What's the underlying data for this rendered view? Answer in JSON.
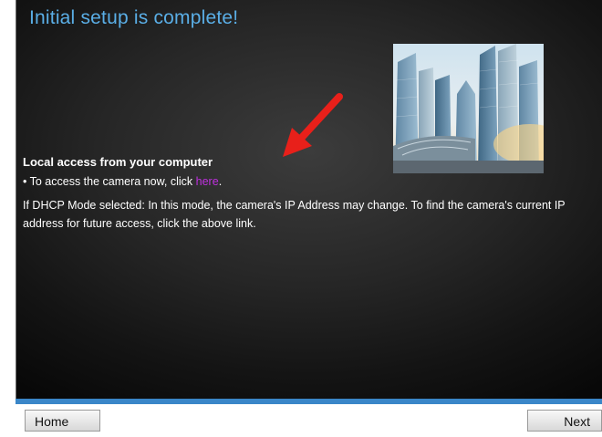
{
  "page": {
    "title": "Initial setup is complete!"
  },
  "content": {
    "heading": "Local access from your computer",
    "bullet_prefix": "• To access the camera now, click ",
    "link_text": "here",
    "bullet_suffix": ".",
    "dhcp_note": "If DHCP Mode selected: In this mode, the camera's IP Address may change. To find the camera's current IP address for future access, click the above link."
  },
  "footer": {
    "home_label": "Home",
    "next_label": "Next"
  },
  "colors": {
    "title": "#5aaee6",
    "link": "#c030e0",
    "accent_bar": "#3a86c8",
    "arrow": "#e8201a"
  },
  "icons": {
    "photo": "city-skyline-image",
    "pointer": "red-arrow-icon"
  }
}
